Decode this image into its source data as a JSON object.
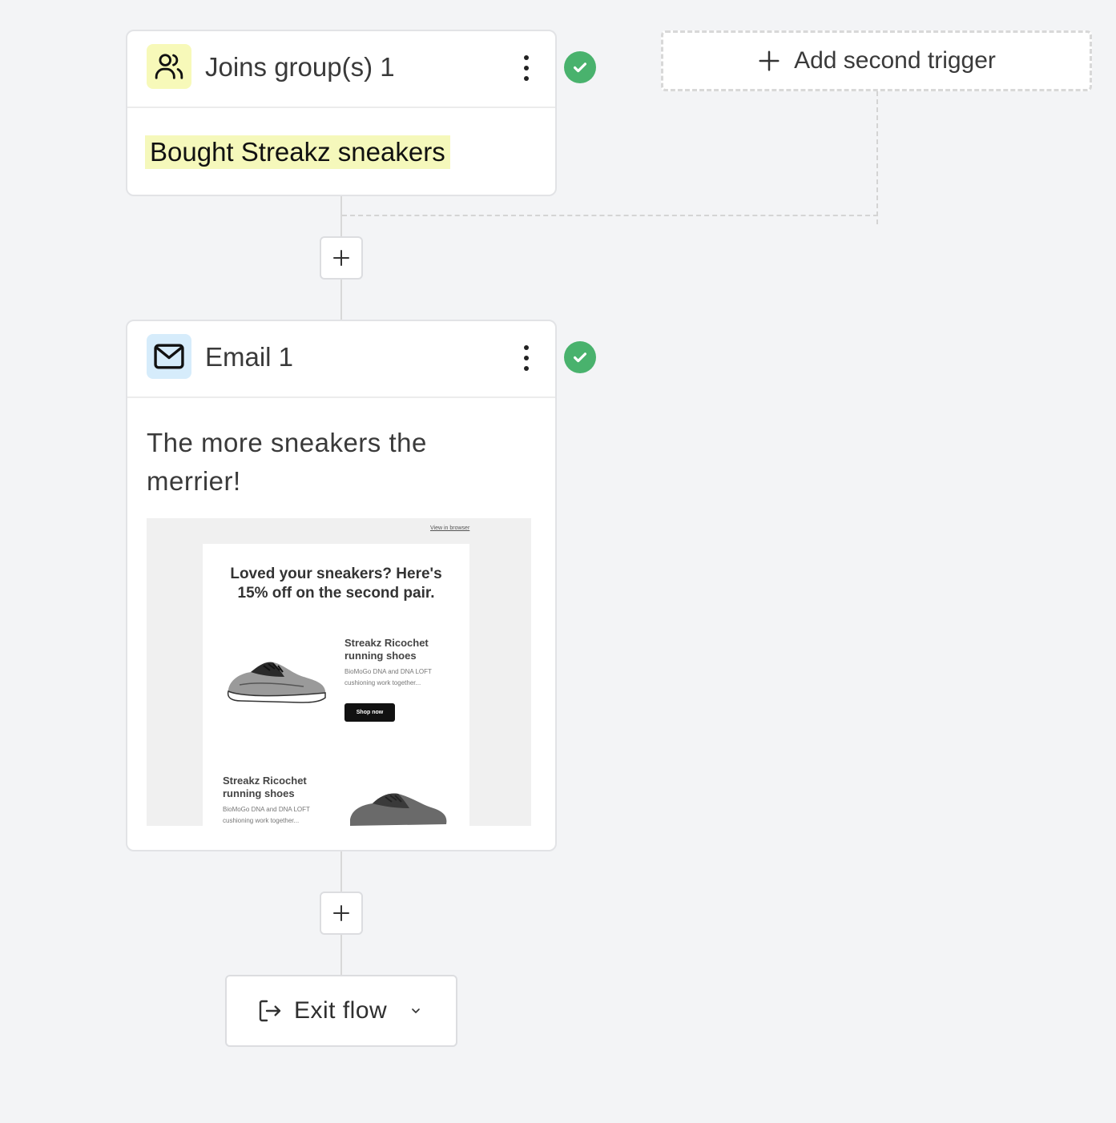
{
  "trigger_node": {
    "title": "Joins group(s) 1",
    "condition": "Bought Streakz sneakers",
    "icon": "users-icon",
    "icon_bg": "#f7f9b9",
    "status": "complete"
  },
  "add_trigger": {
    "label": "Add second trigger"
  },
  "email_node": {
    "title": "Email 1",
    "icon": "envelope-icon",
    "icon_bg": "#d6ecfb",
    "status": "complete",
    "subject": "The more sneakers the merrier!",
    "preview": {
      "view_in_browser": "View in browser",
      "headline": "Loved your sneakers? Here's 15% off on the second pair.",
      "products": [
        {
          "name": "Streakz Ricochet running shoes",
          "description": "BioMoGo DNA and DNA LOFT cushioning work together...",
          "cta": "Shop now"
        },
        {
          "name": "Streakz Ricochet running shoes",
          "description": "BioMoGo DNA and DNA LOFT cushioning work together..."
        }
      ]
    }
  },
  "exit": {
    "label": "Exit flow",
    "icon": "exit-icon"
  },
  "colors": {
    "success": "#49b26d",
    "canvas": "#f3f4f6"
  }
}
